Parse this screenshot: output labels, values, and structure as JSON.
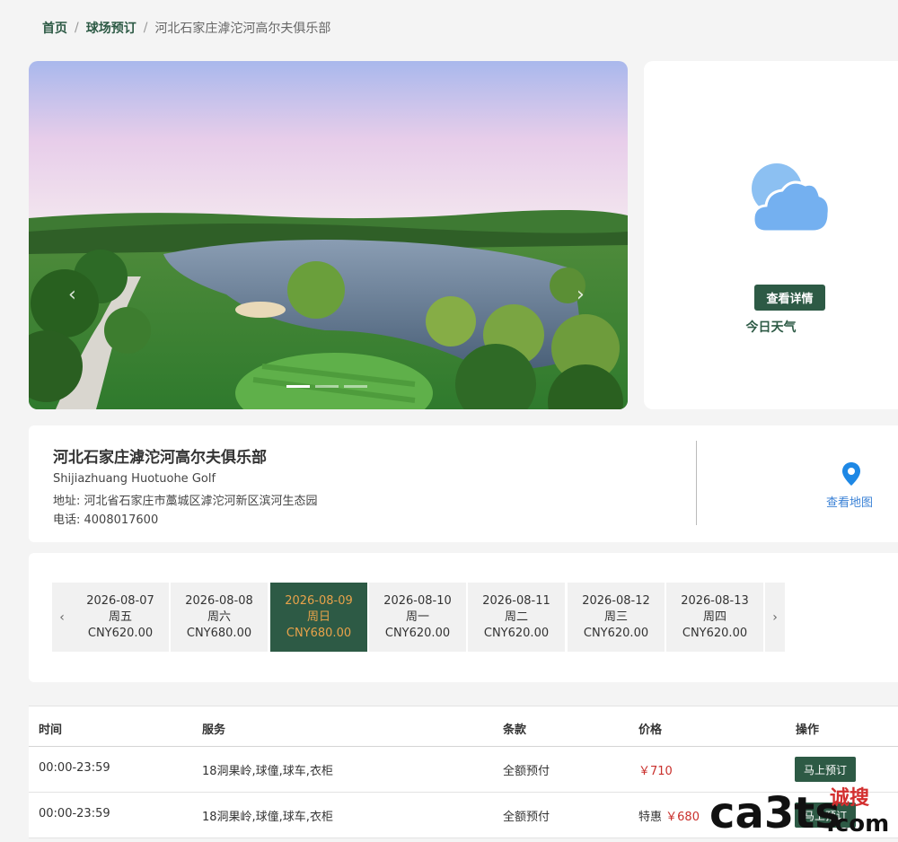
{
  "breadcrumb": {
    "home": "首页",
    "booking": "球场预订",
    "current": "河北石家庄滹沱河高尔夫俱乐部",
    "separator": "/"
  },
  "carousel": {
    "prev_arrow": "‹",
    "next_arrow": "›",
    "slide_count": 3,
    "active_slide": 1
  },
  "weather": {
    "title": "今日天气",
    "details_button": "查看详情",
    "icon": "cloud-sun-icon"
  },
  "club": {
    "name": "河北石家庄滹沱河高尔夫俱乐部",
    "name_en": "Shijiazhuang Huotuohe Golf",
    "address": "地址: 河北省石家庄市藁城区滹沱河新区滨河生态园",
    "phone": "电话: 4008017600",
    "map_label": "查看地图"
  },
  "dates": {
    "prev": "‹",
    "next": "›",
    "items": [
      {
        "date": "2026-08-07",
        "weekday": "周五",
        "price": "CNY620.00"
      },
      {
        "date": "2026-08-08",
        "weekday": "周六",
        "price": "CNY680.00"
      },
      {
        "date": "2026-08-09",
        "weekday": "周日",
        "price": "CNY680.00"
      },
      {
        "date": "2026-08-10",
        "weekday": "周一",
        "price": "CNY620.00"
      },
      {
        "date": "2026-08-11",
        "weekday": "周二",
        "price": "CNY620.00"
      },
      {
        "date": "2026-08-12",
        "weekday": "周三",
        "price": "CNY620.00"
      },
      {
        "date": "2026-08-13",
        "weekday": "周四",
        "price": "CNY620.00"
      }
    ],
    "selected_index": 2
  },
  "table": {
    "headers": {
      "time": "时间",
      "service": "服务",
      "terms": "条款",
      "price": "价格",
      "action": "操作"
    },
    "rows": [
      {
        "time": "00:00-23:59",
        "service": "18洞果岭,球僮,球车,衣柜",
        "terms": "全额预付",
        "tag": "",
        "price": "￥710",
        "button": "马上预订"
      },
      {
        "time": "00:00-23:59",
        "service": "18洞果岭,球僮,球车,衣柜",
        "terms": "全额预付",
        "tag": "特惠",
        "price": "￥680",
        "button": "马上预订"
      }
    ]
  },
  "watermark": {
    "text": "ca3ts",
    "cn": "诚搜",
    "suffix": ".com"
  },
  "colors": {
    "primary": "#2d5a45",
    "accent": "#e8a24a",
    "price": "#c9302c",
    "link": "#3b82d6"
  }
}
